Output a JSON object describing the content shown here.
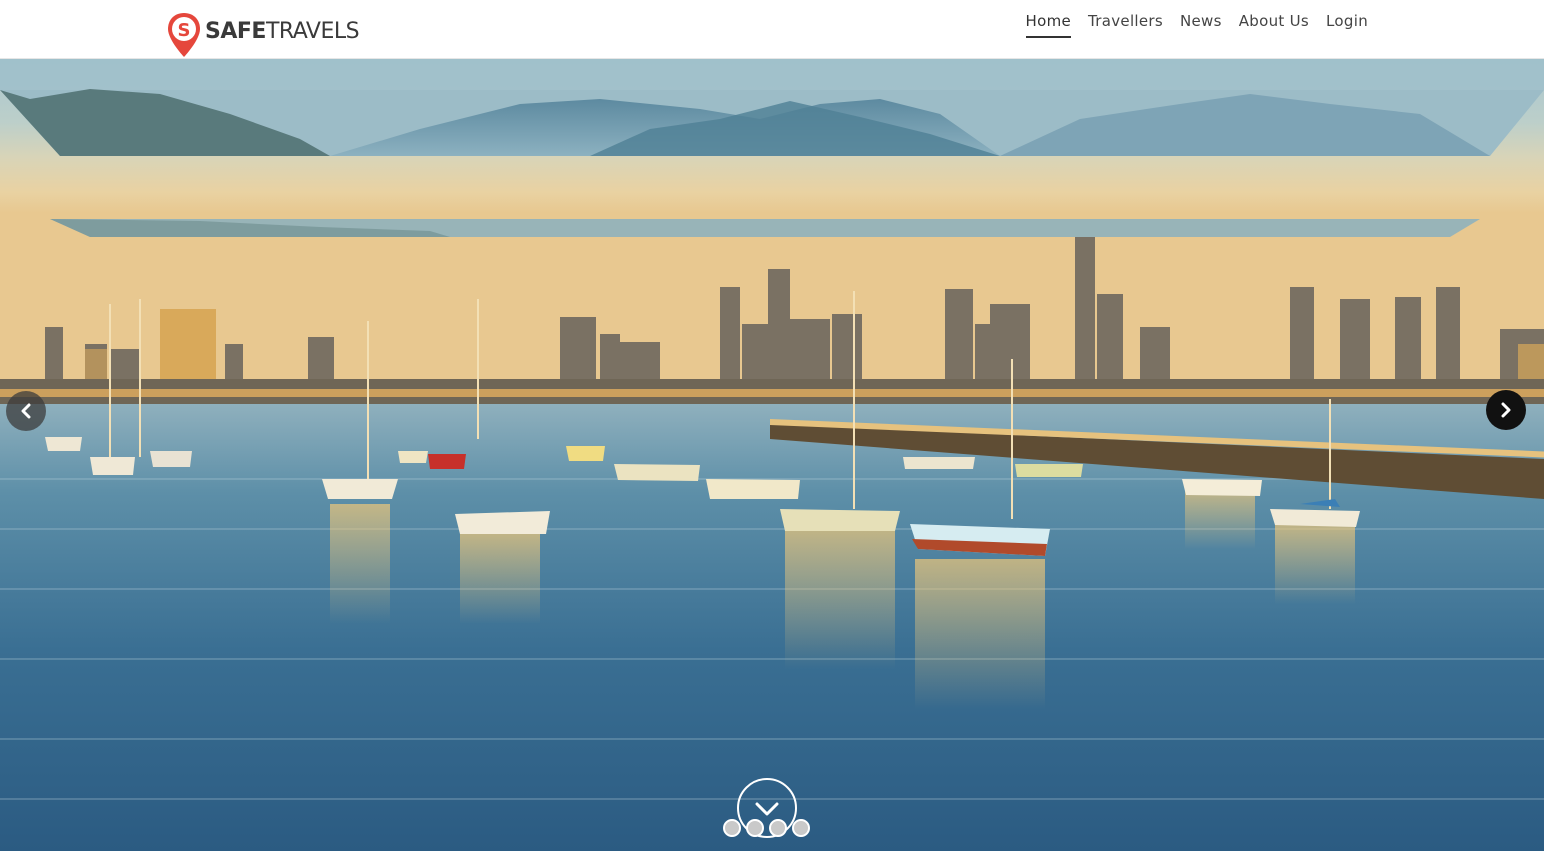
{
  "brand": {
    "name_bold": "SAFE",
    "name_light": "TRAVELS",
    "accent_color": "#e5473c"
  },
  "nav": {
    "items": [
      {
        "label": "Home",
        "active": true
      },
      {
        "label": "Travellers",
        "active": false
      },
      {
        "label": "News",
        "active": false
      },
      {
        "label": "About Us",
        "active": false
      },
      {
        "label": "Login",
        "active": false
      }
    ]
  },
  "hero": {
    "prev_icon": "chevron-left-icon",
    "next_icon": "chevron-right-icon",
    "scroll_icon": "chevron-down-icon",
    "slides_count": 4,
    "active_slide": 1
  }
}
